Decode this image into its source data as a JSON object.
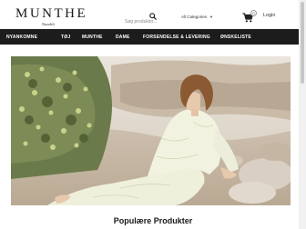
{
  "brand": {
    "name": "MUNTHE",
    "tagline": "Baradeli"
  },
  "search": {
    "placeholder": "Søg produkter..."
  },
  "category": {
    "selected": "All Categories"
  },
  "cart": {
    "count": "0"
  },
  "account": {
    "login_label": "Login"
  },
  "nav": {
    "items": [
      {
        "label": "NYANKOMNE"
      },
      {
        "label": "TØJ"
      },
      {
        "label": "MUNTHE"
      },
      {
        "label": "DAME"
      },
      {
        "label": "FORSENDELSE & LEVERING"
      },
      {
        "label": "ØNSKELISTE"
      }
    ]
  },
  "hero": {
    "icon": "hero-photo"
  },
  "section": {
    "title": "Populære Produkter"
  },
  "colors": {
    "nav_bg": "#1c1c1c",
    "nav_text": "#ffffff",
    "brand": "#1a1a1a"
  },
  "icons": {
    "search": "search-icon",
    "cart": "cart-icon",
    "dropdown": "chevron-down-icon"
  }
}
